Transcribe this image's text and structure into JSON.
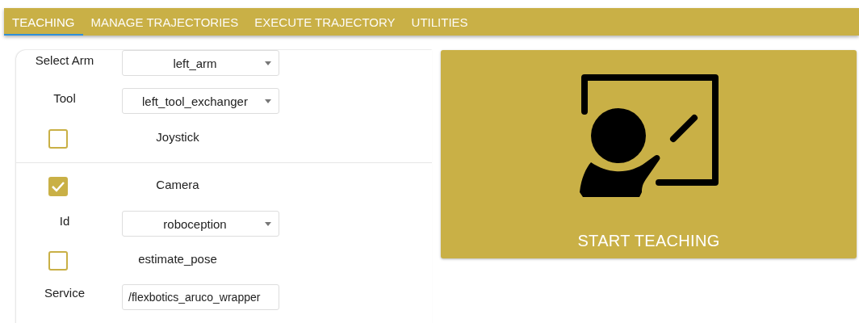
{
  "tabs": [
    {
      "label": "TEACHING",
      "selected": true
    },
    {
      "label": "MANAGE TRAJECTORIES",
      "selected": false
    },
    {
      "label": "EXECUTE TRAJECTORY",
      "selected": false
    },
    {
      "label": "UTILITIES",
      "selected": false
    }
  ],
  "form": {
    "sections": [
      {
        "rows": [
          {
            "kind": "select",
            "label": "Select Arm",
            "value": "left_arm"
          },
          {
            "kind": "select",
            "label": "Tool",
            "value": "left_tool_exchanger"
          },
          {
            "kind": "checkbox",
            "label": "Joystick",
            "checked": false
          }
        ]
      },
      {
        "rows": [
          {
            "kind": "checkbox",
            "label": "Camera",
            "checked": true
          },
          {
            "kind": "select",
            "label": "Id",
            "value": "roboception"
          },
          {
            "kind": "checkbox",
            "label": "estimate_pose",
            "checked": false
          },
          {
            "kind": "text",
            "label": "Service",
            "value": "/flexbotics_aruco_wrapper"
          }
        ]
      }
    ]
  },
  "start_button": {
    "label": "START TEACHING"
  }
}
